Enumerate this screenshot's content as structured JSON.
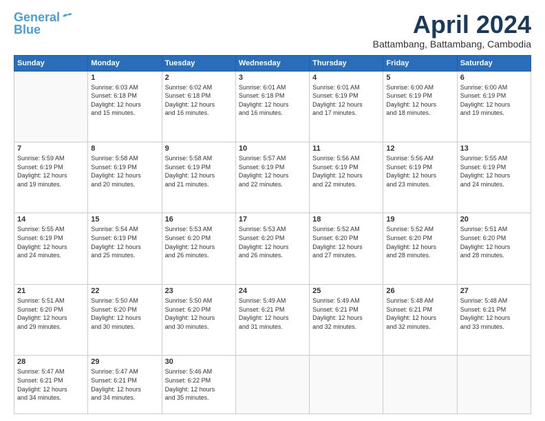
{
  "logo": {
    "line1": "General",
    "line2": "Blue"
  },
  "title": "April 2024",
  "location": "Battambang, Battambang, Cambodia",
  "days_header": [
    "Sunday",
    "Monday",
    "Tuesday",
    "Wednesday",
    "Thursday",
    "Friday",
    "Saturday"
  ],
  "weeks": [
    [
      {
        "day": "",
        "info": ""
      },
      {
        "day": "1",
        "info": "Sunrise: 6:03 AM\nSunset: 6:18 PM\nDaylight: 12 hours\nand 15 minutes."
      },
      {
        "day": "2",
        "info": "Sunrise: 6:02 AM\nSunset: 6:18 PM\nDaylight: 12 hours\nand 16 minutes."
      },
      {
        "day": "3",
        "info": "Sunrise: 6:01 AM\nSunset: 6:18 PM\nDaylight: 12 hours\nand 16 minutes."
      },
      {
        "day": "4",
        "info": "Sunrise: 6:01 AM\nSunset: 6:19 PM\nDaylight: 12 hours\nand 17 minutes."
      },
      {
        "day": "5",
        "info": "Sunrise: 6:00 AM\nSunset: 6:19 PM\nDaylight: 12 hours\nand 18 minutes."
      },
      {
        "day": "6",
        "info": "Sunrise: 6:00 AM\nSunset: 6:19 PM\nDaylight: 12 hours\nand 19 minutes."
      }
    ],
    [
      {
        "day": "7",
        "info": "Sunrise: 5:59 AM\nSunset: 6:19 PM\nDaylight: 12 hours\nand 19 minutes."
      },
      {
        "day": "8",
        "info": "Sunrise: 5:58 AM\nSunset: 6:19 PM\nDaylight: 12 hours\nand 20 minutes."
      },
      {
        "day": "9",
        "info": "Sunrise: 5:58 AM\nSunset: 6:19 PM\nDaylight: 12 hours\nand 21 minutes."
      },
      {
        "day": "10",
        "info": "Sunrise: 5:57 AM\nSunset: 6:19 PM\nDaylight: 12 hours\nand 22 minutes."
      },
      {
        "day": "11",
        "info": "Sunrise: 5:56 AM\nSunset: 6:19 PM\nDaylight: 12 hours\nand 22 minutes."
      },
      {
        "day": "12",
        "info": "Sunrise: 5:56 AM\nSunset: 6:19 PM\nDaylight: 12 hours\nand 23 minutes."
      },
      {
        "day": "13",
        "info": "Sunrise: 5:55 AM\nSunset: 6:19 PM\nDaylight: 12 hours\nand 24 minutes."
      }
    ],
    [
      {
        "day": "14",
        "info": "Sunrise: 5:55 AM\nSunset: 6:19 PM\nDaylight: 12 hours\nand 24 minutes."
      },
      {
        "day": "15",
        "info": "Sunrise: 5:54 AM\nSunset: 6:19 PM\nDaylight: 12 hours\nand 25 minutes."
      },
      {
        "day": "16",
        "info": "Sunrise: 5:53 AM\nSunset: 6:20 PM\nDaylight: 12 hours\nand 26 minutes."
      },
      {
        "day": "17",
        "info": "Sunrise: 5:53 AM\nSunset: 6:20 PM\nDaylight: 12 hours\nand 26 minutes."
      },
      {
        "day": "18",
        "info": "Sunrise: 5:52 AM\nSunset: 6:20 PM\nDaylight: 12 hours\nand 27 minutes."
      },
      {
        "day": "19",
        "info": "Sunrise: 5:52 AM\nSunset: 6:20 PM\nDaylight: 12 hours\nand 28 minutes."
      },
      {
        "day": "20",
        "info": "Sunrise: 5:51 AM\nSunset: 6:20 PM\nDaylight: 12 hours\nand 28 minutes."
      }
    ],
    [
      {
        "day": "21",
        "info": "Sunrise: 5:51 AM\nSunset: 6:20 PM\nDaylight: 12 hours\nand 29 minutes."
      },
      {
        "day": "22",
        "info": "Sunrise: 5:50 AM\nSunset: 6:20 PM\nDaylight: 12 hours\nand 30 minutes."
      },
      {
        "day": "23",
        "info": "Sunrise: 5:50 AM\nSunset: 6:20 PM\nDaylight: 12 hours\nand 30 minutes."
      },
      {
        "day": "24",
        "info": "Sunrise: 5:49 AM\nSunset: 6:21 PM\nDaylight: 12 hours\nand 31 minutes."
      },
      {
        "day": "25",
        "info": "Sunrise: 5:49 AM\nSunset: 6:21 PM\nDaylight: 12 hours\nand 32 minutes."
      },
      {
        "day": "26",
        "info": "Sunrise: 5:48 AM\nSunset: 6:21 PM\nDaylight: 12 hours\nand 32 minutes."
      },
      {
        "day": "27",
        "info": "Sunrise: 5:48 AM\nSunset: 6:21 PM\nDaylight: 12 hours\nand 33 minutes."
      }
    ],
    [
      {
        "day": "28",
        "info": "Sunrise: 5:47 AM\nSunset: 6:21 PM\nDaylight: 12 hours\nand 34 minutes."
      },
      {
        "day": "29",
        "info": "Sunrise: 5:47 AM\nSunset: 6:21 PM\nDaylight: 12 hours\nand 34 minutes."
      },
      {
        "day": "30",
        "info": "Sunrise: 5:46 AM\nSunset: 6:22 PM\nDaylight: 12 hours\nand 35 minutes."
      },
      {
        "day": "",
        "info": ""
      },
      {
        "day": "",
        "info": ""
      },
      {
        "day": "",
        "info": ""
      },
      {
        "day": "",
        "info": ""
      }
    ]
  ]
}
